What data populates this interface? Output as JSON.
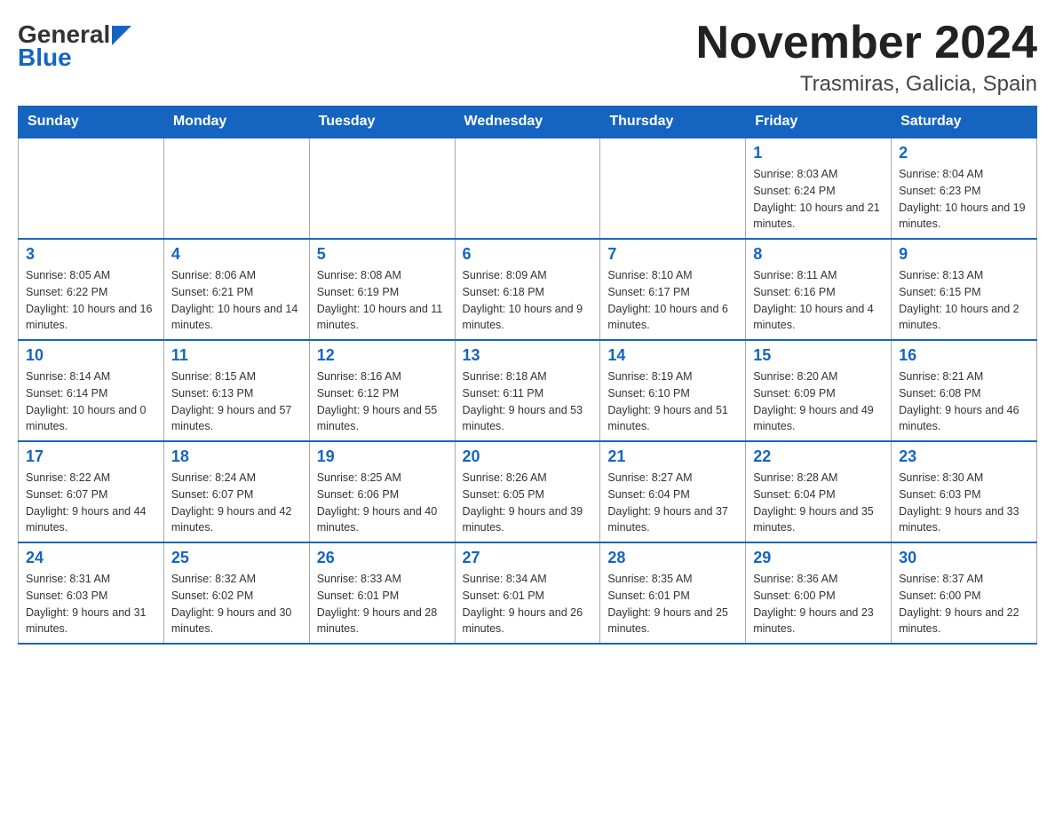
{
  "logo": {
    "general": "General",
    "blue": "Blue",
    "arrow": "▶"
  },
  "title": "November 2024",
  "location": "Trasmiras, Galicia, Spain",
  "headers": [
    "Sunday",
    "Monday",
    "Tuesday",
    "Wednesday",
    "Thursday",
    "Friday",
    "Saturday"
  ],
  "weeks": [
    [
      {
        "day": "",
        "sunrise": "",
        "sunset": "",
        "daylight": ""
      },
      {
        "day": "",
        "sunrise": "",
        "sunset": "",
        "daylight": ""
      },
      {
        "day": "",
        "sunrise": "",
        "sunset": "",
        "daylight": ""
      },
      {
        "day": "",
        "sunrise": "",
        "sunset": "",
        "daylight": ""
      },
      {
        "day": "",
        "sunrise": "",
        "sunset": "",
        "daylight": ""
      },
      {
        "day": "1",
        "sunrise": "Sunrise: 8:03 AM",
        "sunset": "Sunset: 6:24 PM",
        "daylight": "Daylight: 10 hours and 21 minutes."
      },
      {
        "day": "2",
        "sunrise": "Sunrise: 8:04 AM",
        "sunset": "Sunset: 6:23 PM",
        "daylight": "Daylight: 10 hours and 19 minutes."
      }
    ],
    [
      {
        "day": "3",
        "sunrise": "Sunrise: 8:05 AM",
        "sunset": "Sunset: 6:22 PM",
        "daylight": "Daylight: 10 hours and 16 minutes."
      },
      {
        "day": "4",
        "sunrise": "Sunrise: 8:06 AM",
        "sunset": "Sunset: 6:21 PM",
        "daylight": "Daylight: 10 hours and 14 minutes."
      },
      {
        "day": "5",
        "sunrise": "Sunrise: 8:08 AM",
        "sunset": "Sunset: 6:19 PM",
        "daylight": "Daylight: 10 hours and 11 minutes."
      },
      {
        "day": "6",
        "sunrise": "Sunrise: 8:09 AM",
        "sunset": "Sunset: 6:18 PM",
        "daylight": "Daylight: 10 hours and 9 minutes."
      },
      {
        "day": "7",
        "sunrise": "Sunrise: 8:10 AM",
        "sunset": "Sunset: 6:17 PM",
        "daylight": "Daylight: 10 hours and 6 minutes."
      },
      {
        "day": "8",
        "sunrise": "Sunrise: 8:11 AM",
        "sunset": "Sunset: 6:16 PM",
        "daylight": "Daylight: 10 hours and 4 minutes."
      },
      {
        "day": "9",
        "sunrise": "Sunrise: 8:13 AM",
        "sunset": "Sunset: 6:15 PM",
        "daylight": "Daylight: 10 hours and 2 minutes."
      }
    ],
    [
      {
        "day": "10",
        "sunrise": "Sunrise: 8:14 AM",
        "sunset": "Sunset: 6:14 PM",
        "daylight": "Daylight: 10 hours and 0 minutes."
      },
      {
        "day": "11",
        "sunrise": "Sunrise: 8:15 AM",
        "sunset": "Sunset: 6:13 PM",
        "daylight": "Daylight: 9 hours and 57 minutes."
      },
      {
        "day": "12",
        "sunrise": "Sunrise: 8:16 AM",
        "sunset": "Sunset: 6:12 PM",
        "daylight": "Daylight: 9 hours and 55 minutes."
      },
      {
        "day": "13",
        "sunrise": "Sunrise: 8:18 AM",
        "sunset": "Sunset: 6:11 PM",
        "daylight": "Daylight: 9 hours and 53 minutes."
      },
      {
        "day": "14",
        "sunrise": "Sunrise: 8:19 AM",
        "sunset": "Sunset: 6:10 PM",
        "daylight": "Daylight: 9 hours and 51 minutes."
      },
      {
        "day": "15",
        "sunrise": "Sunrise: 8:20 AM",
        "sunset": "Sunset: 6:09 PM",
        "daylight": "Daylight: 9 hours and 49 minutes."
      },
      {
        "day": "16",
        "sunrise": "Sunrise: 8:21 AM",
        "sunset": "Sunset: 6:08 PM",
        "daylight": "Daylight: 9 hours and 46 minutes."
      }
    ],
    [
      {
        "day": "17",
        "sunrise": "Sunrise: 8:22 AM",
        "sunset": "Sunset: 6:07 PM",
        "daylight": "Daylight: 9 hours and 44 minutes."
      },
      {
        "day": "18",
        "sunrise": "Sunrise: 8:24 AM",
        "sunset": "Sunset: 6:07 PM",
        "daylight": "Daylight: 9 hours and 42 minutes."
      },
      {
        "day": "19",
        "sunrise": "Sunrise: 8:25 AM",
        "sunset": "Sunset: 6:06 PM",
        "daylight": "Daylight: 9 hours and 40 minutes."
      },
      {
        "day": "20",
        "sunrise": "Sunrise: 8:26 AM",
        "sunset": "Sunset: 6:05 PM",
        "daylight": "Daylight: 9 hours and 39 minutes."
      },
      {
        "day": "21",
        "sunrise": "Sunrise: 8:27 AM",
        "sunset": "Sunset: 6:04 PM",
        "daylight": "Daylight: 9 hours and 37 minutes."
      },
      {
        "day": "22",
        "sunrise": "Sunrise: 8:28 AM",
        "sunset": "Sunset: 6:04 PM",
        "daylight": "Daylight: 9 hours and 35 minutes."
      },
      {
        "day": "23",
        "sunrise": "Sunrise: 8:30 AM",
        "sunset": "Sunset: 6:03 PM",
        "daylight": "Daylight: 9 hours and 33 minutes."
      }
    ],
    [
      {
        "day": "24",
        "sunrise": "Sunrise: 8:31 AM",
        "sunset": "Sunset: 6:03 PM",
        "daylight": "Daylight: 9 hours and 31 minutes."
      },
      {
        "day": "25",
        "sunrise": "Sunrise: 8:32 AM",
        "sunset": "Sunset: 6:02 PM",
        "daylight": "Daylight: 9 hours and 30 minutes."
      },
      {
        "day": "26",
        "sunrise": "Sunrise: 8:33 AM",
        "sunset": "Sunset: 6:01 PM",
        "daylight": "Daylight: 9 hours and 28 minutes."
      },
      {
        "day": "27",
        "sunrise": "Sunrise: 8:34 AM",
        "sunset": "Sunset: 6:01 PM",
        "daylight": "Daylight: 9 hours and 26 minutes."
      },
      {
        "day": "28",
        "sunrise": "Sunrise: 8:35 AM",
        "sunset": "Sunset: 6:01 PM",
        "daylight": "Daylight: 9 hours and 25 minutes."
      },
      {
        "day": "29",
        "sunrise": "Sunrise: 8:36 AM",
        "sunset": "Sunset: 6:00 PM",
        "daylight": "Daylight: 9 hours and 23 minutes."
      },
      {
        "day": "30",
        "sunrise": "Sunrise: 8:37 AM",
        "sunset": "Sunset: 6:00 PM",
        "daylight": "Daylight: 9 hours and 22 minutes."
      }
    ]
  ]
}
